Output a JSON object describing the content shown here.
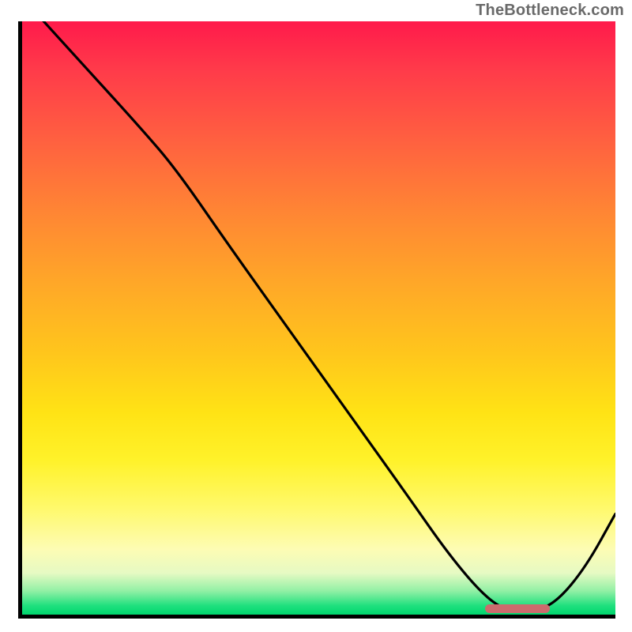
{
  "watermark": "TheBottleneck.com",
  "colors": {
    "gradient_top": "#ff1a4b",
    "gradient_bottom": "#00d66e",
    "curve": "#000000",
    "marker": "#cc6b6d",
    "axis": "#000000",
    "watermark_text": "#6a6a6a"
  },
  "chart_data": {
    "type": "line",
    "title": "",
    "xlabel": "",
    "ylabel": "",
    "xlim": [
      0,
      1
    ],
    "ylim": [
      0,
      1
    ],
    "x": [
      0.0,
      0.1,
      0.2,
      0.26,
      0.35,
      0.45,
      0.55,
      0.65,
      0.72,
      0.78,
      0.82,
      0.86,
      0.9,
      0.95,
      1.0
    ],
    "values": [
      1.04,
      0.93,
      0.82,
      0.75,
      0.62,
      0.48,
      0.34,
      0.2,
      0.1,
      0.03,
      0.005,
      0.005,
      0.02,
      0.08,
      0.17
    ],
    "marker": {
      "x_start": 0.78,
      "x_end": 0.89,
      "y": 0.01
    },
    "grid": false,
    "legend": false
  }
}
